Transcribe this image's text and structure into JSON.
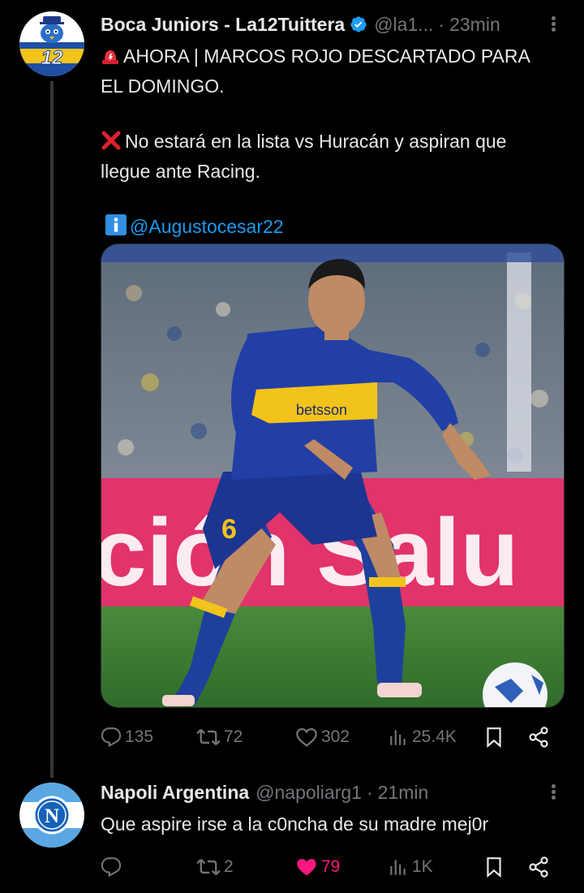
{
  "tweet1": {
    "author_name": "Boca Juniors - La12Tuittera",
    "handle": "@la1...",
    "separator": "·",
    "time": "23min",
    "avatar_text": "12",
    "lines": {
      "l1": "AHORA | MARCOS ROJO DESCARTADO PARA",
      "l2": "EL DOMINGO.",
      "l3": "No estará en la lista vs Huracán y aspiran que",
      "l4": "llegue ante Racing.",
      "mention": "@Augustocesar22"
    },
    "image_ad_text": "betsson",
    "image_board_text": "ción Salu",
    "shirt_number": "6",
    "stats": {
      "replies": "135",
      "retweets": "72",
      "likes": "302",
      "views": "25.4K"
    }
  },
  "tweet2": {
    "author_name": "Napoli Argentina",
    "handle": "@napoliarg1",
    "separator": "·",
    "time": "21min",
    "avatar_letter": "N",
    "text": "Que aspire irse a la c0ncha de su madre mej0r",
    "stats": {
      "replies": "",
      "retweets": "2",
      "likes": "79",
      "views": "1K"
    }
  },
  "colors": {
    "background": "#000000",
    "text": "#e7e9ea",
    "muted": "#71767b",
    "link": "#1d9bf0",
    "like": "#f91880",
    "boca_blue": "#1e3a8a",
    "boca_yellow": "#f2c31b"
  },
  "icons": [
    "verified-badge-icon",
    "more-options-icon",
    "siren-emoji",
    "cross-mark-emoji",
    "info-emoji",
    "reply-icon",
    "retweet-icon",
    "like-icon",
    "views-icon",
    "bookmark-icon",
    "share-icon"
  ]
}
